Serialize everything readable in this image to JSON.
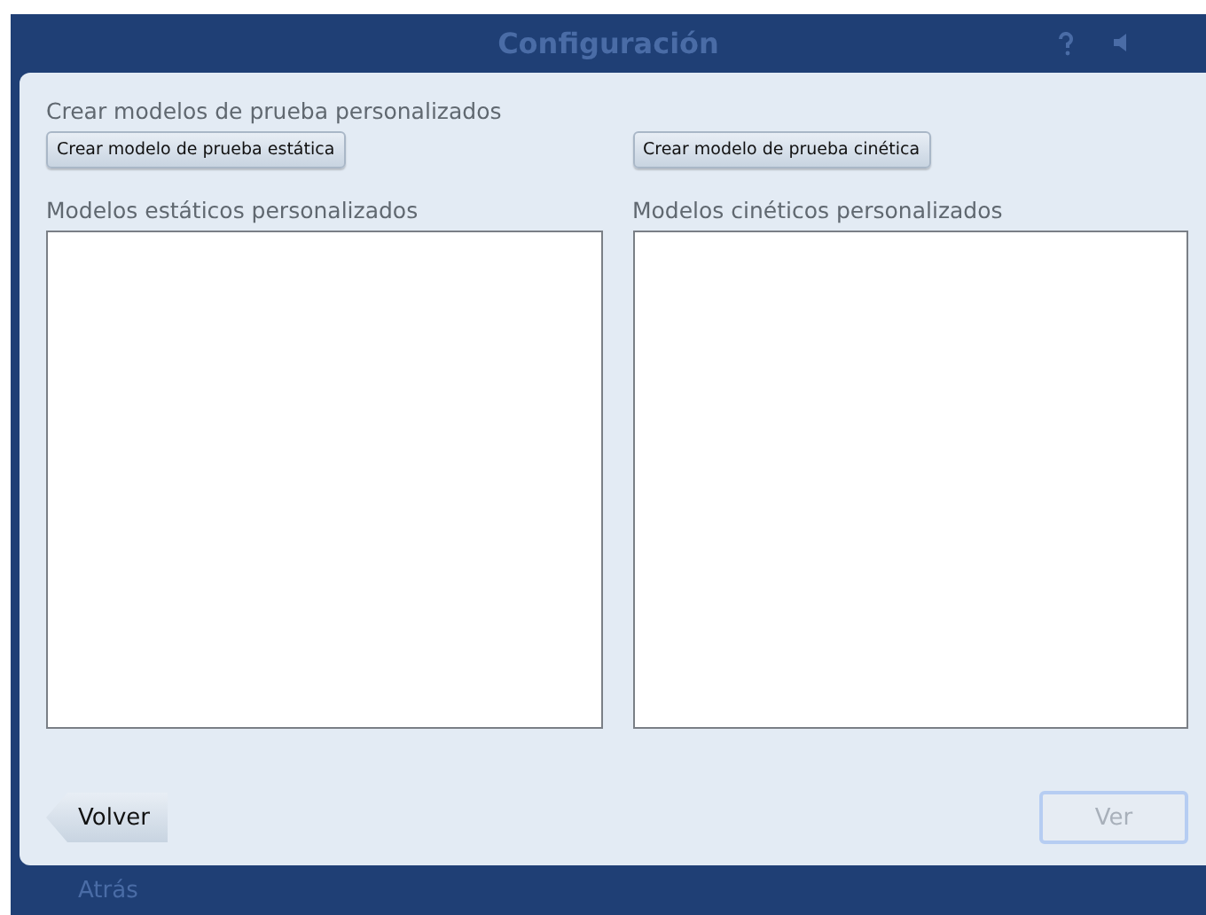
{
  "window": {
    "title": "Configuración",
    "back_label": "Atrás"
  },
  "dialog": {
    "heading": "Crear modelos de prueba personalizados",
    "create_buttons": [
      "Crear modelo de prueba estática",
      "Crear modelo de prueba cinética"
    ],
    "lists": [
      {
        "title": "Modelos estáticos personalizados"
      },
      {
        "title": "Modelos cinéticos personalizados"
      }
    ],
    "back_button": {
      "label": "Volver"
    },
    "view_button": {
      "label": "Ver",
      "disabled": true
    }
  }
}
